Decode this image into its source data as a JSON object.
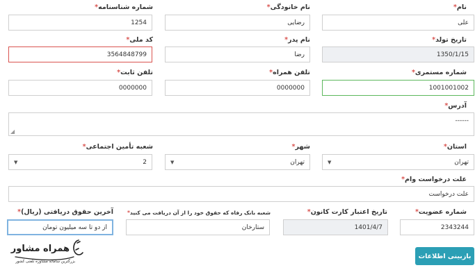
{
  "labels": {
    "first_name": "نام",
    "last_name": "نام خانودگی",
    "id_number": "شماره شناسنامه",
    "birth_date": "تاریخ تولد",
    "father_name": "نام پدر",
    "national_code": "کد ملی",
    "subscriber_number": "شماره مستمری",
    "mobile": "تلفن همراه",
    "landline": "تلفن ثابت",
    "address": "آدرس",
    "province": "استان",
    "city": "شهر",
    "social_branch": "شعبه تأمین اجتماعی",
    "loan_reason": "علت درخواست وام",
    "membership_number": "شماره عضویت",
    "card_expiry": "تاریخ اعتبار کارت کانون",
    "bank_branch": "شعبه بانک رفاه که حقوق خود را از آن دریافت می کنید",
    "last_salary": "آخرین حقوق دریافتی (ریال)"
  },
  "required_mark": "*",
  "values": {
    "first_name": "علی",
    "last_name": "رضایی",
    "id_number": "1254",
    "birth_date": "1350/1/15",
    "father_name": "رضا",
    "national_code": "3564848799",
    "subscriber_number": "1001001002",
    "mobile": "0000000",
    "landline": "0000000",
    "address": "------",
    "province": "تهران",
    "city": "تهران",
    "social_branch": "2",
    "loan_reason": "علت درخواست",
    "membership_number": "2343244",
    "card_expiry": "1401/4/7",
    "bank_branch": "ستارخان",
    "last_salary": "از دو تا سه میلیون تومان"
  },
  "submit_button": "بازبینی اطلاعات",
  "logo": {
    "title": "همراه مشاور",
    "tagline": "بزرگترین سامانه مشاوره تلفنی کشور"
  },
  "colors": {
    "error_border": "#d9534f",
    "success_border": "#5cb85c",
    "focus_border": "#7fb3e0",
    "button": "#2b9fb5",
    "readonly_bg": "#eef0f3"
  }
}
